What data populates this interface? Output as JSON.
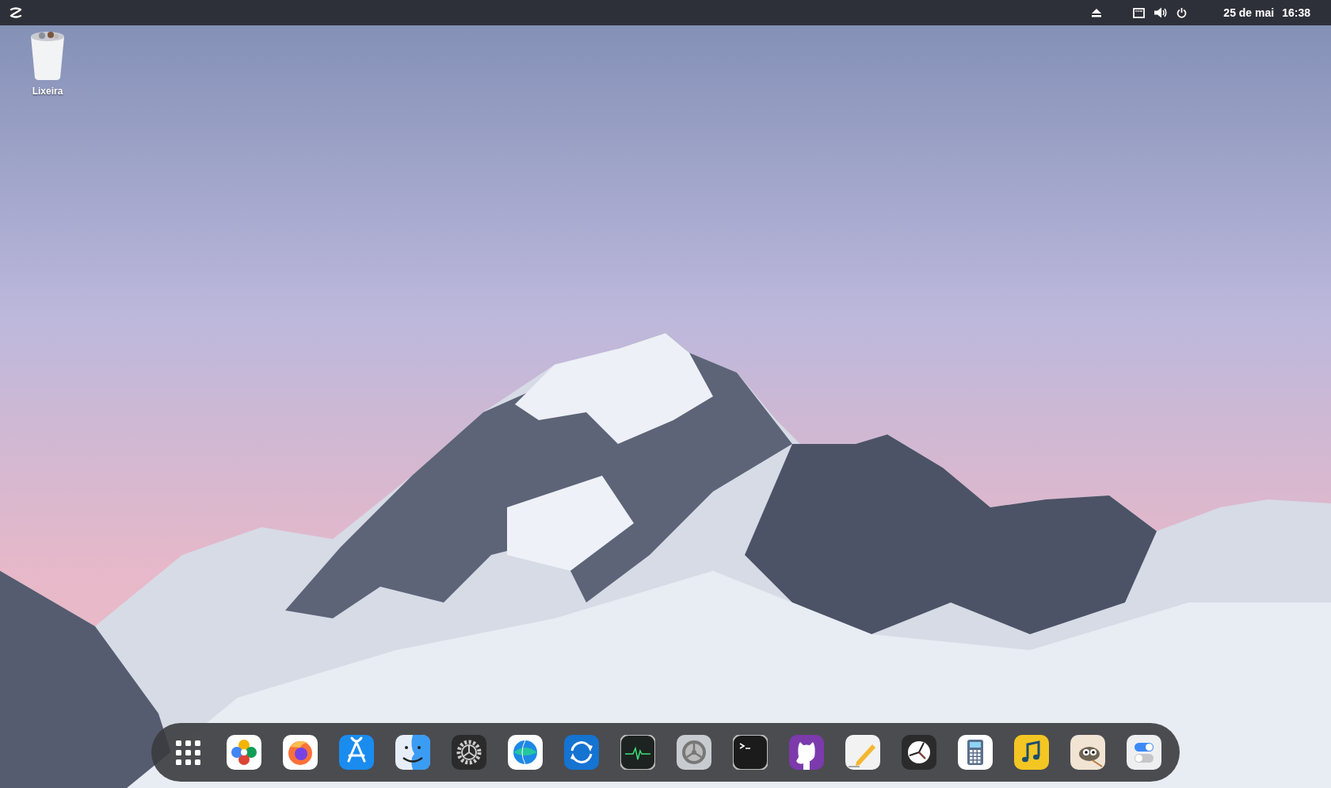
{
  "top_bar": {
    "date": "25 de mai",
    "time": "16:38"
  },
  "desktop_icons": [
    {
      "label": "Lixeira"
    }
  ],
  "dock": {
    "apps": [
      {
        "kind": "grid"
      },
      {
        "kind": "photos"
      },
      {
        "kind": "firefox"
      },
      {
        "kind": "appstore"
      },
      {
        "kind": "finder"
      },
      {
        "kind": "gear"
      },
      {
        "kind": "globe"
      },
      {
        "kind": "sync"
      },
      {
        "kind": "monitor"
      },
      {
        "kind": "settings"
      },
      {
        "kind": "terminal"
      },
      {
        "kind": "github"
      },
      {
        "kind": "pencil"
      },
      {
        "kind": "clock"
      },
      {
        "kind": "calculator"
      },
      {
        "kind": "music"
      },
      {
        "kind": "gimp"
      },
      {
        "kind": "toggles"
      }
    ]
  }
}
